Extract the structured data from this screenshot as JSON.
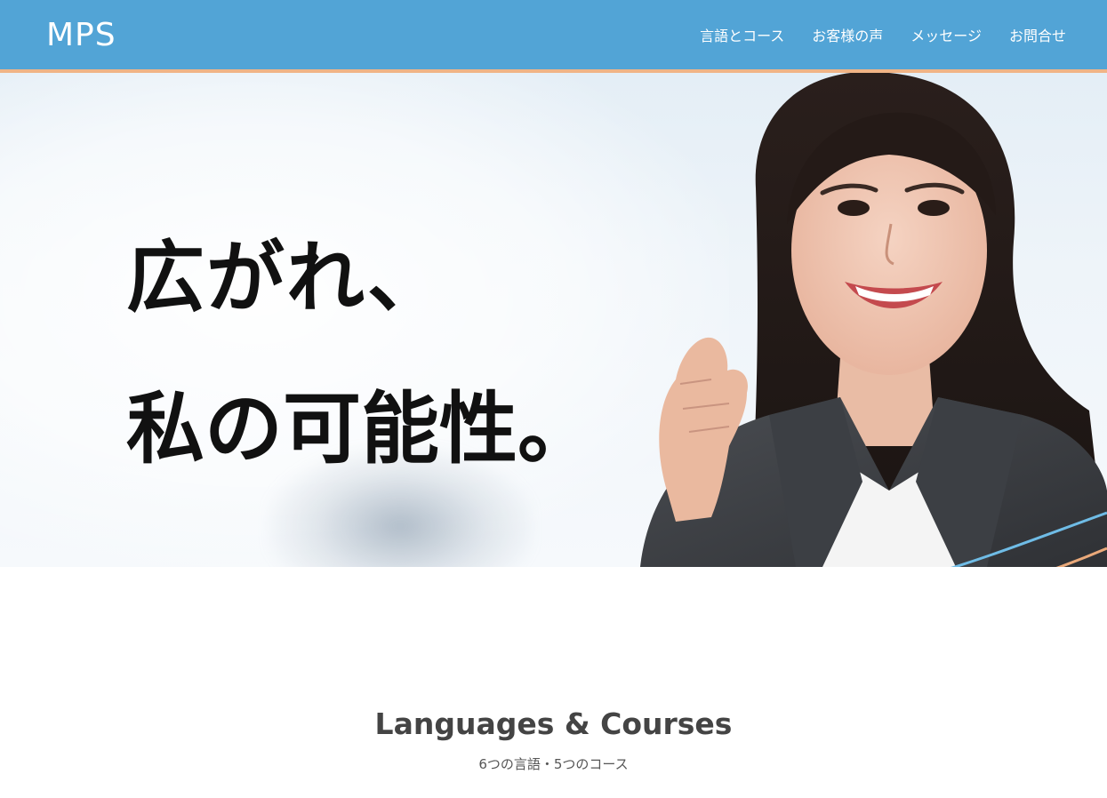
{
  "header": {
    "logo": "MPS",
    "nav": [
      {
        "label": "言語とコース"
      },
      {
        "label": "お客様の声"
      },
      {
        "label": "メッセージ"
      },
      {
        "label": "お問合せ"
      }
    ]
  },
  "hero": {
    "headline_line1": "広がれ、",
    "headline_line2": "私の可能性。"
  },
  "section": {
    "title": "Languages & Courses",
    "subtitle": "6つの言語・5つのコース"
  },
  "colors": {
    "header_bg": "#52a4d6",
    "header_stripe": "#f0b486",
    "wave_blue": "#6fbce6",
    "wave_orange": "#eaa97a"
  }
}
